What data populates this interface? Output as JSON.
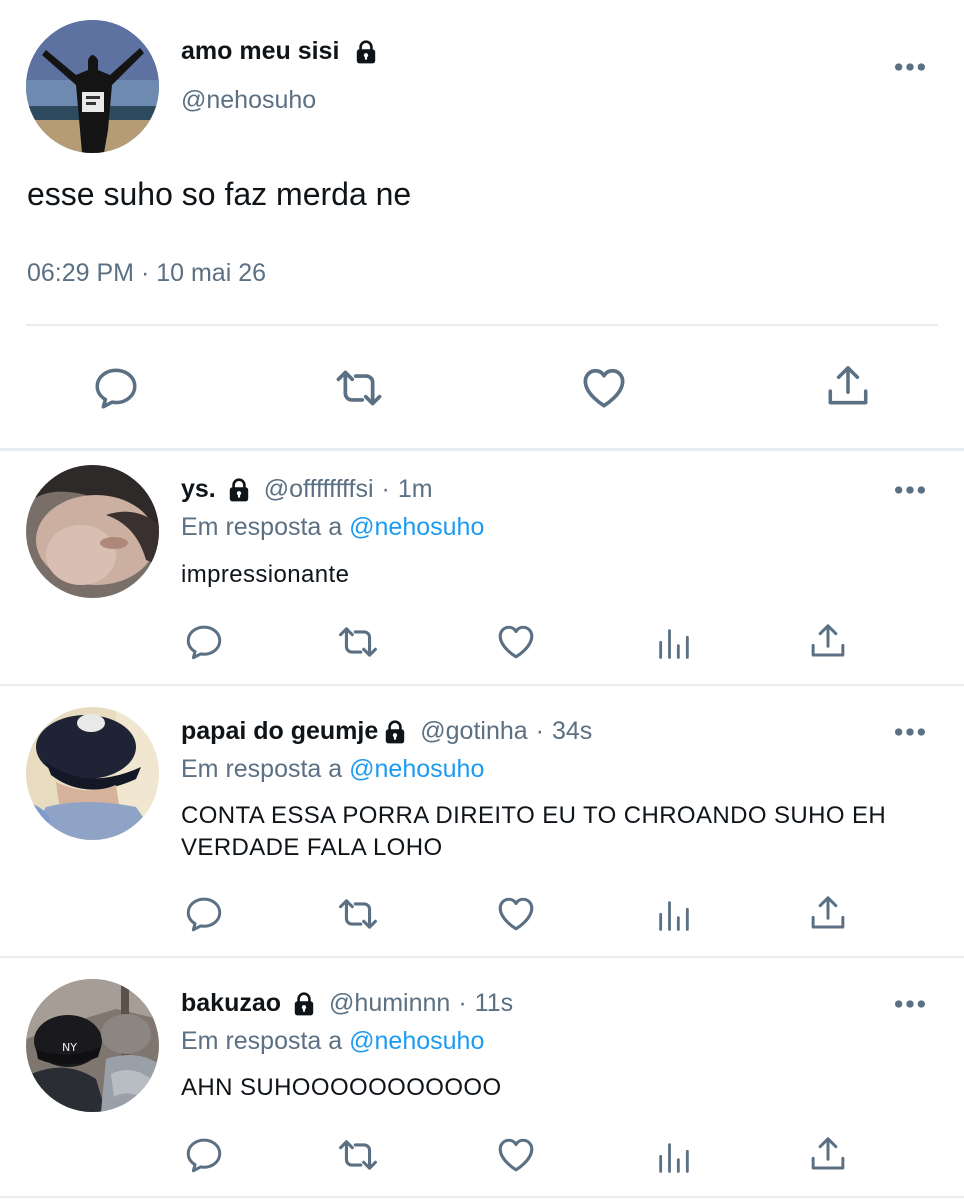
{
  "main_tweet": {
    "display_name": "amo meu sisi",
    "handle": "@nehosuho",
    "text": "esse suho so faz merda ne",
    "timestamp": "06:29 PM · 10 mai 26",
    "actions": [
      "reply-icon",
      "retweet-icon",
      "like-icon",
      "share-icon"
    ]
  },
  "replies": [
    {
      "display_name": "ys.",
      "handle": "@offffffffsi",
      "separator": "·",
      "time": "1m",
      "replying_prefix": "Em resposta a",
      "replying_to": "@nehosuho",
      "text": "impressionante"
    },
    {
      "display_name": "papai do geumje",
      "handle": "@gotinha",
      "separator": "·",
      "time": "34s",
      "replying_prefix": "Em resposta a",
      "replying_to": "@nehosuho",
      "text": "CONTA ESSA PORRA DIREITO EU TO CHROANDO SUHO EH VERDADE FALA LOHO"
    },
    {
      "display_name": "bakuzao",
      "handle": "@huminnn",
      "separator": "·",
      "time": "11s",
      "replying_prefix": "Em resposta a",
      "replying_to": "@nehosuho",
      "text": "AHN SUHOOOOOOOOOOO"
    }
  ],
  "colors": {
    "text_primary": "#0f1419",
    "text_secondary": "#5b7083",
    "link": "#1d9bf0",
    "icon": "#5b7083",
    "divider": "#e6ecf0"
  }
}
